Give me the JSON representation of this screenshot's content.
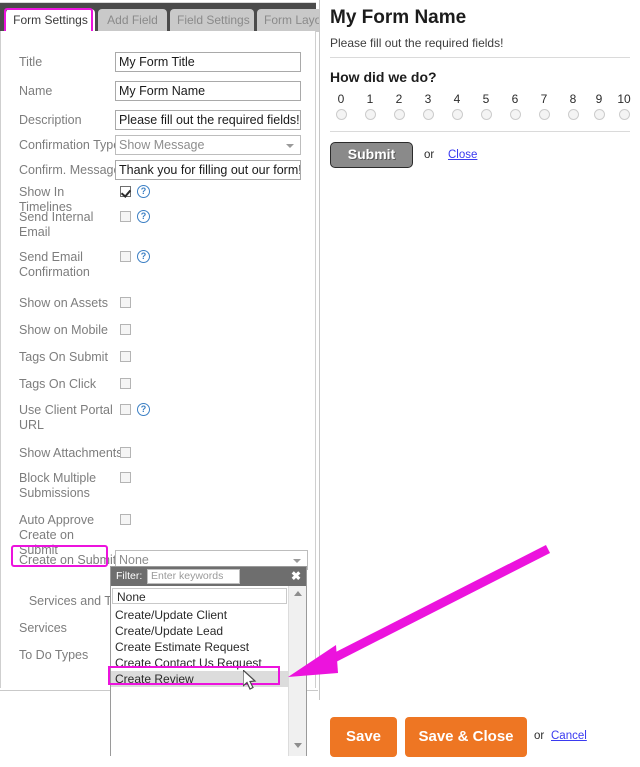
{
  "tabs": [
    {
      "label": "Form Settings",
      "active": true
    },
    {
      "label": "Add Field",
      "active": false
    },
    {
      "label": "Field Settings",
      "active": false
    },
    {
      "label": "Form Layout",
      "active": false
    }
  ],
  "settings": {
    "text_fields": [
      {
        "label": "Title",
        "value": "My Form Title"
      },
      {
        "label": "Name",
        "value": "My Form Name"
      },
      {
        "label": "Description",
        "value": "Please fill out the required fields!"
      }
    ],
    "confirmation_type": {
      "label": "Confirmation Type",
      "value": "Show Message"
    },
    "confirm_message": {
      "label": "Confirm. Message",
      "value": "Thank you for filling out our form!"
    },
    "checkboxes": [
      {
        "label": "Show In Timelines",
        "checked": true,
        "help": true
      },
      {
        "label": "Send Internal Email",
        "checked": false,
        "help": true
      },
      {
        "label": "Send Email Confirmation",
        "checked": false,
        "help": true
      },
      {
        "label": "Show on Assets",
        "checked": false,
        "help": false
      },
      {
        "label": "Show on Mobile",
        "checked": false,
        "help": false
      },
      {
        "label": "Tags On Submit",
        "checked": false,
        "help": false
      },
      {
        "label": "Tags On Click",
        "checked": false,
        "help": false
      },
      {
        "label": "Use Client Portal URL",
        "checked": false,
        "help": true
      },
      {
        "label": "Show Attachments",
        "checked": false,
        "help": false
      },
      {
        "label": "Block Multiple Submissions",
        "checked": false,
        "help": false
      },
      {
        "label": "Auto Approve Create on Submit",
        "checked": false,
        "help": false
      }
    ],
    "create_on_submit": {
      "label": "Create on Submit",
      "value": "None"
    },
    "obscured_labels": [
      {
        "label": "Services and T"
      },
      {
        "label": "Services"
      },
      {
        "label": "To Do Types"
      }
    ]
  },
  "dropdown": {
    "filter_label": "Filter:",
    "filter_placeholder": "Enter keywords",
    "close_icon": "✖",
    "options": [
      "None",
      "Create/Update Client",
      "Create/Update Lead",
      "Create Estimate Request",
      "Create Contact Us Request",
      "Create Review"
    ],
    "selected_option": "Create Review"
  },
  "preview": {
    "title": "My Form Name",
    "subtitle": "Please fill out the required fields!",
    "question": "How did we do?",
    "scale": [
      "0",
      "1",
      "2",
      "3",
      "4",
      "5",
      "6",
      "7",
      "8",
      "9",
      "10"
    ],
    "submit_label": "Submit",
    "or_label": "or",
    "close_label": "Close"
  },
  "footer": {
    "save_label": "Save",
    "save_close_label": "Save & Close",
    "or_label": "or",
    "cancel_label": "Cancel"
  },
  "colors": {
    "highlight": "#ec13dd",
    "orange": "#ee7623",
    "tabbar": "#4b4b4b",
    "link": "#3a3af0"
  }
}
